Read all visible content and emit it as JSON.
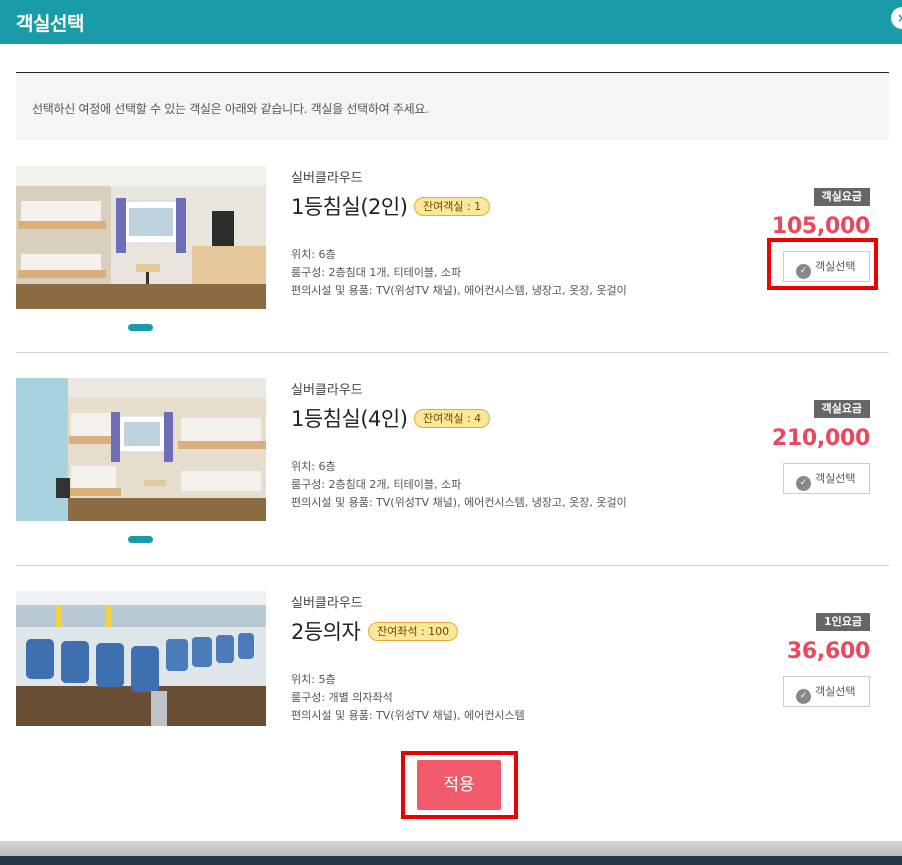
{
  "header": {
    "title": "객실선택"
  },
  "close_label": "×",
  "notice": {
    "text": "선택하신 여정에 선택할 수 있는 객실은 아래와 같습니다. 객실을 선택하여 주세요."
  },
  "rooms": [
    {
      "brand": "실버클라우드",
      "name": "1등침실(2인)",
      "badge": "잔여객실 : 1",
      "location": "위치: 6층",
      "layout": "룸구성: 2층침대 1개, 티테이블, 소파",
      "amenities": "편의시설 및 용품: TV(위성TV 채널), 에어컨시스템, 냉장고, 옷장, 옷걸이",
      "fare_label": "객실요금",
      "price": "105,000",
      "select_label": "객실선택"
    },
    {
      "brand": "실버클라우드",
      "name": "1등침실(4인)",
      "badge": "잔여객실 : 4",
      "location": "위치: 6층",
      "layout": "룸구성: 2층침대 2개, 티테이블, 소파",
      "amenities": "편의시설 및 용품: TV(위성TV 채널), 에어컨시스템, 냉장고, 옷장, 옷걸이",
      "fare_label": "객실요금",
      "price": "210,000",
      "select_label": "객실선택"
    },
    {
      "brand": "실버클라우드",
      "name": "2등의자",
      "badge": "잔여좌석 : 100",
      "location": "위치: 5층",
      "layout": "룸구성: 개별 의자좌석",
      "amenities": "편의시설 및 용품: TV(위성TV 채널), 에어컨시스템",
      "fare_label": "1인요금",
      "price": "36,600",
      "select_label": "객실선택"
    }
  ],
  "apply_label": "적용",
  "colors": {
    "header": "#1a9ca8",
    "price": "#e8495c",
    "apply": "#f05a6b",
    "highlight": "#ec0000"
  },
  "icons": {
    "select": "check-circle-icon",
    "close": "close-icon"
  }
}
